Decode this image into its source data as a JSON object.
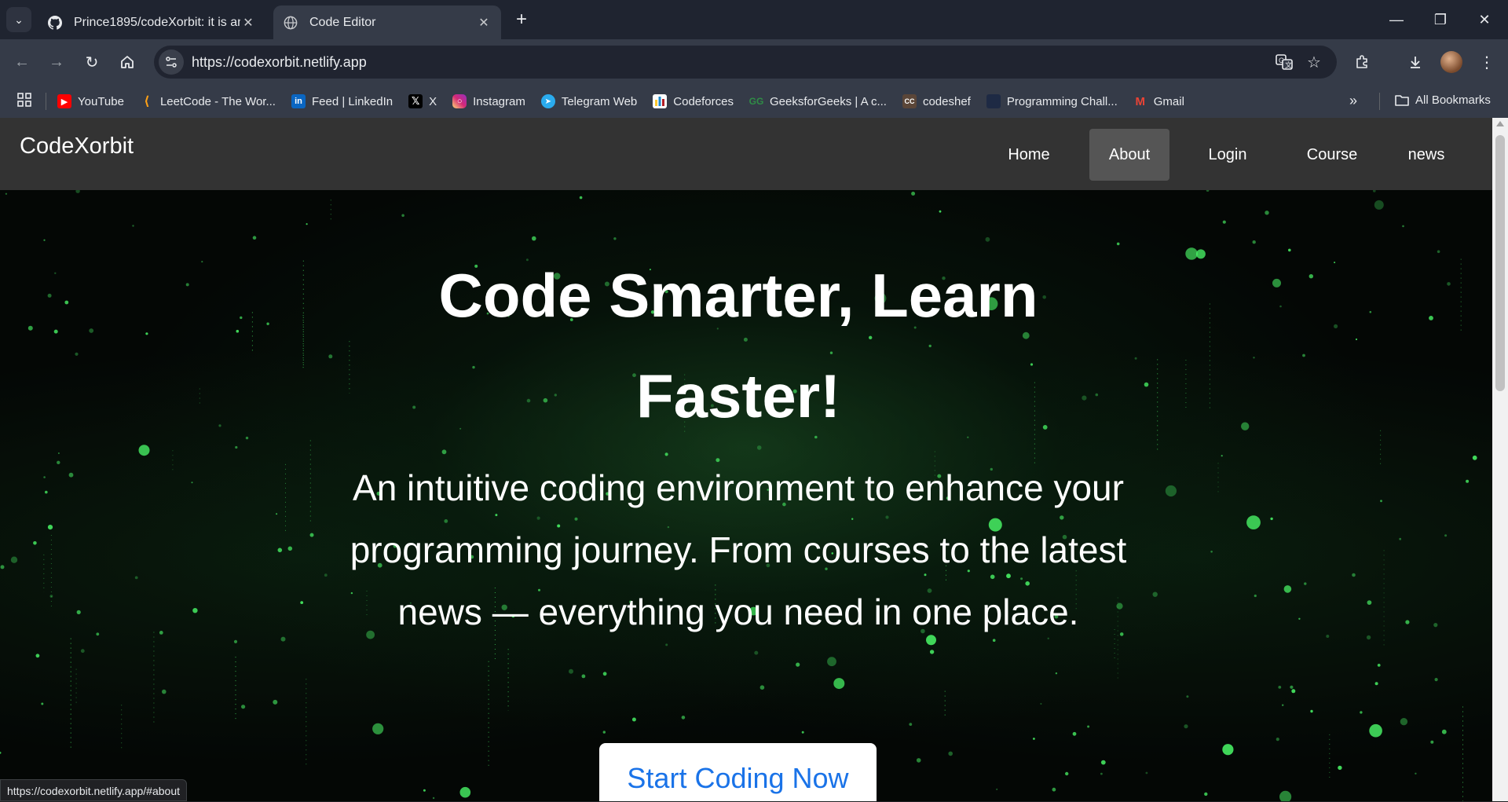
{
  "browser": {
    "tabs": [
      {
        "title": "Prince1895/codeXorbit: it is an ",
        "icon": "github-icon",
        "active": false
      },
      {
        "title": "Code Editor",
        "icon": "globe-icon",
        "active": true
      }
    ],
    "address_bar": {
      "url": "https://codexorbit.netlify.app"
    },
    "bookmarks": [
      {
        "label": "YouTube",
        "icon": "youtube-icon",
        "color": "#ff0000"
      },
      {
        "label": "LeetCode - The Wor...",
        "icon": "leetcode-icon",
        "color": "#ffa116"
      },
      {
        "label": "Feed | LinkedIn",
        "icon": "linkedin-icon",
        "color": "#0a66c2"
      },
      {
        "label": "X",
        "icon": "x-icon",
        "color": "#000000"
      },
      {
        "label": "Instagram",
        "icon": "instagram-icon",
        "color": "#e1306c"
      },
      {
        "label": "Telegram Web",
        "icon": "telegram-icon",
        "color": "#2aabee"
      },
      {
        "label": "Codeforces",
        "icon": "codeforces-icon",
        "color": "#1f8acb"
      },
      {
        "label": "GeeksforGeeks | A c...",
        "icon": "geeksforgeeks-icon",
        "color": "#2f8d46"
      },
      {
        "label": "codeshef",
        "icon": "codechef-icon",
        "color": "#5b4638"
      },
      {
        "label": "Programming Chall...",
        "icon": "hackerrank-icon",
        "color": "#1e2a44"
      },
      {
        "label": "Gmail",
        "icon": "gmail-icon",
        "color": "#ea4335"
      }
    ],
    "all_bookmarks_label": "All Bookmarks",
    "status_url": "https://codexorbit.netlify.app/#about"
  },
  "site": {
    "logo": "CodeXorbit",
    "nav": [
      {
        "label": "Home",
        "active": false
      },
      {
        "label": "About",
        "active": true
      },
      {
        "label": "Login",
        "active": false
      },
      {
        "label": "Course",
        "active": false
      },
      {
        "label": "news",
        "active": false
      }
    ],
    "hero": {
      "title": "Code Smarter, Learn Faster!",
      "subtitle": "An intuitive coding environment to enhance your programming journey. From courses to the latest news — everything you need in one place.",
      "cta_label": "Start Coding Now"
    }
  },
  "colors": {
    "accent": "#1a73e8",
    "nav_bg": "#333333",
    "nav_active": "#555555",
    "matrix_green": "#4cff6a"
  }
}
